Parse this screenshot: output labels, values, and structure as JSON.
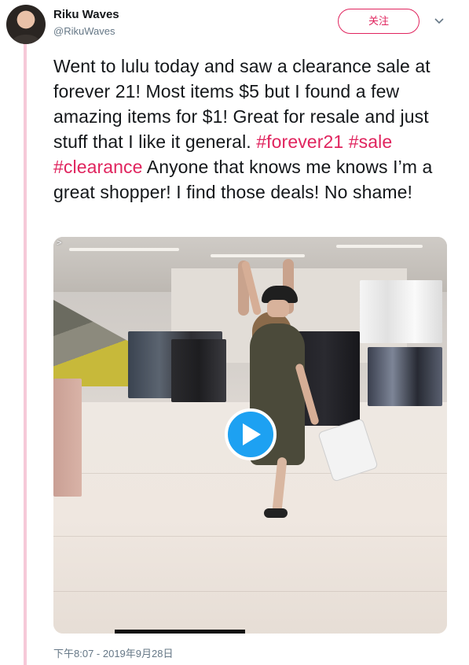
{
  "author": {
    "name": "Riku Waves",
    "handle": "@RikuWaves"
  },
  "follow_button": {
    "label": "关注"
  },
  "menu_icon": "chevron-down-icon",
  "tweet": {
    "text_parts": [
      {
        "type": "text",
        "value": "Went to lulu today and saw a clearance sale at forever 21! Most items $5 but I found a few amazing items for $1! Great for resale and just stuff that I like it general. "
      },
      {
        "type": "hashtag",
        "value": "#forever21"
      },
      {
        "type": "text",
        "value": " "
      },
      {
        "type": "hashtag",
        "value": "#sale"
      },
      {
        "type": "text",
        "value": " "
      },
      {
        "type": "hashtag",
        "value": "#clearance"
      },
      {
        "type": "text",
        "value": " Anyone that knows me knows I’m a great shopper! I find those deals! No shame!"
      }
    ]
  },
  "media": {
    "type": "video",
    "corner_mark": ">",
    "play_icon": "play-icon"
  },
  "timestamp": "下午8:07 - 2019年9月28日",
  "colors": {
    "accent": "#e0245e",
    "thread_line": "#f6c9d8",
    "play_button": "#1da1f2",
    "secondary_text": "#657786"
  }
}
